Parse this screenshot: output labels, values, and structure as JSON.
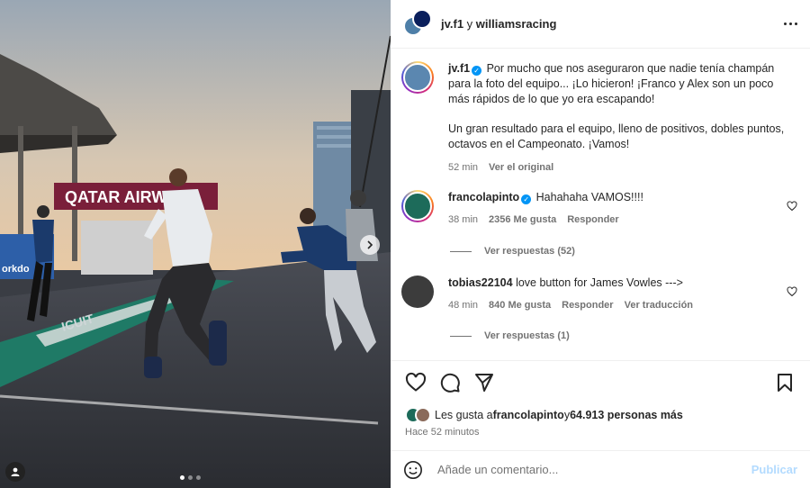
{
  "header": {
    "user1": "jv.f1",
    "connector": " y ",
    "user2": "williamsracing"
  },
  "caption": {
    "username": "jv.f1",
    "text1": "Por mucho que nos aseguraron que nadie tenía champán para la foto del equipo... ¡Lo hicieron! ¡Franco y Alex son un poco más rápidos de lo que yo era escapando!",
    "text2": "Un gran resultado para el equipo, lleno de positivos, dobles puntos, octavos en el Campeonato. ¡Vamos!",
    "time": "52 min",
    "see_original": "Ver el original"
  },
  "comments": [
    {
      "username": "francolapinto",
      "text": "Hahahaha VAMOS!!!!",
      "time": "38 min",
      "likes": "2356 Me gusta",
      "reply": "Responder",
      "replies": "Ver respuestas (52)"
    },
    {
      "username": "tobias22104",
      "text": "love button for James Vowles --->",
      "time": "48 min",
      "likes": "840 Me gusta",
      "reply": "Responder",
      "translate": "Ver traducción",
      "replies": "Ver respuestas (1)"
    }
  ],
  "likes": {
    "prefix": "Les gusta a ",
    "user": "francolapinto",
    "connector": " y ",
    "count": "64.913 personas más"
  },
  "posted": "Hace 52 minutos",
  "add_comment": {
    "placeholder": "Añade un comentario...",
    "publish": "Publicar"
  },
  "photo": {
    "sign": "QATAR AIRW",
    "pit_text": "ICUIT",
    "left_sign": "orkdo"
  },
  "icons": {
    "like": "heart-icon",
    "comment": "comment-icon",
    "share": "send-icon",
    "save": "bookmark-icon",
    "emoji": "emoji-icon",
    "more": "more-icon",
    "next": "chevron-right-icon"
  }
}
